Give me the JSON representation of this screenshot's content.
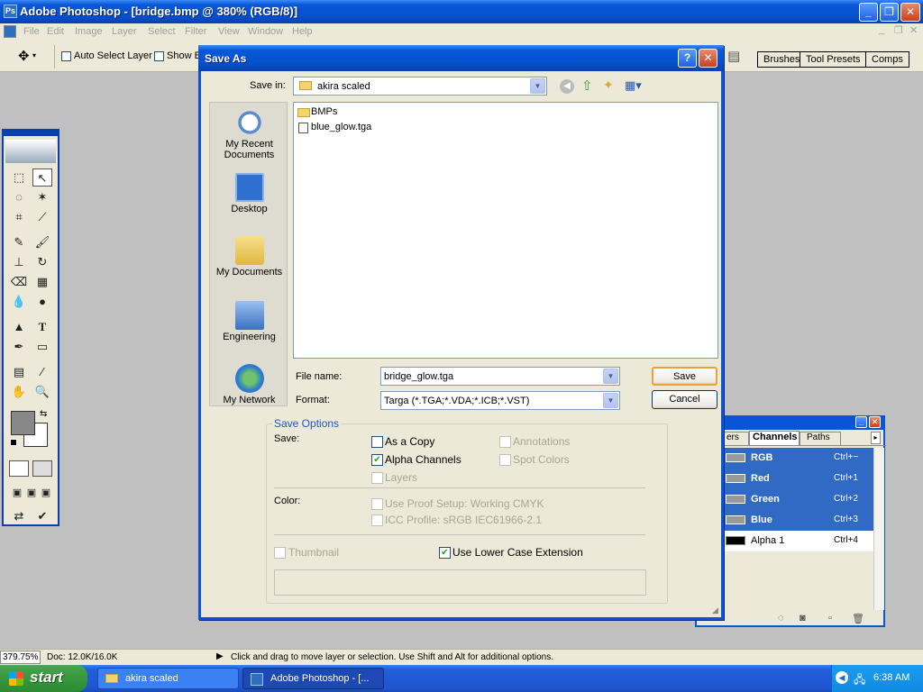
{
  "app": {
    "title": "Adobe Photoshop - [bridge.bmp @ 380% (RGB/8)]",
    "logo": "Ps"
  },
  "window_controls": {
    "minimize": "_",
    "restore": "❐",
    "close": "✕"
  },
  "menu": [
    "File",
    "Edit",
    "Image",
    "Layer",
    "Select",
    "Filter",
    "View",
    "Window",
    "Help"
  ],
  "options_bar": {
    "auto_select": "Auto Select Layer",
    "show_bounds": "Show B",
    "tabs": [
      "Brushes",
      "Tool Presets",
      "Comps"
    ]
  },
  "dialog": {
    "title": "Save As",
    "help": "?",
    "save_in_label": "Save in:",
    "save_in_value": "akira scaled",
    "places": [
      "My Recent Documents",
      "Desktop",
      "My Documents",
      "Engineering",
      "My Network"
    ],
    "files": [
      {
        "name": "BMPs",
        "type": "folder"
      },
      {
        "name": "blue_glow.tga",
        "type": "file"
      }
    ],
    "file_name_label": "File name:",
    "file_name_value": "bridge_glow.tga",
    "format_label": "Format:",
    "format_value": "Targa (*.TGA;*.VDA;*.ICB;*.VST)",
    "save_btn": "Save",
    "cancel_btn": "Cancel",
    "save_options": {
      "title": "Save Options",
      "save_label": "Save:",
      "as_copy": "As a Copy",
      "annotations": "Annotations",
      "alpha_channels": "Alpha Channels",
      "spot_colors": "Spot Colors",
      "layers": "Layers",
      "color_label": "Color:",
      "proof_setup": "Use Proof Setup:  Working CMYK",
      "icc_profile": "ICC Profile:  sRGB IEC61966-2.1",
      "thumbnail": "Thumbnail",
      "lower_case": "Use Lower Case Extension"
    }
  },
  "channels_palette": {
    "tabs": [
      "ers",
      "Channels",
      "Paths"
    ],
    "rows": [
      {
        "name": "RGB",
        "shortcut": "Ctrl+~"
      },
      {
        "name": "Red",
        "shortcut": "Ctrl+1"
      },
      {
        "name": "Green",
        "shortcut": "Ctrl+2"
      },
      {
        "name": "Blue",
        "shortcut": "Ctrl+3"
      },
      {
        "name": "Alpha 1",
        "shortcut": "Ctrl+4"
      }
    ]
  },
  "status_bar": {
    "zoom": "379.75%",
    "doc": "Doc: 12.0K/16.0K",
    "hint": "Click and drag to move layer or selection.  Use Shift and Alt for additional options."
  },
  "taskbar": {
    "start": "start",
    "tasks": [
      "akira scaled",
      "Adobe Photoshop - [..."
    ],
    "clock": "6:38 AM"
  }
}
